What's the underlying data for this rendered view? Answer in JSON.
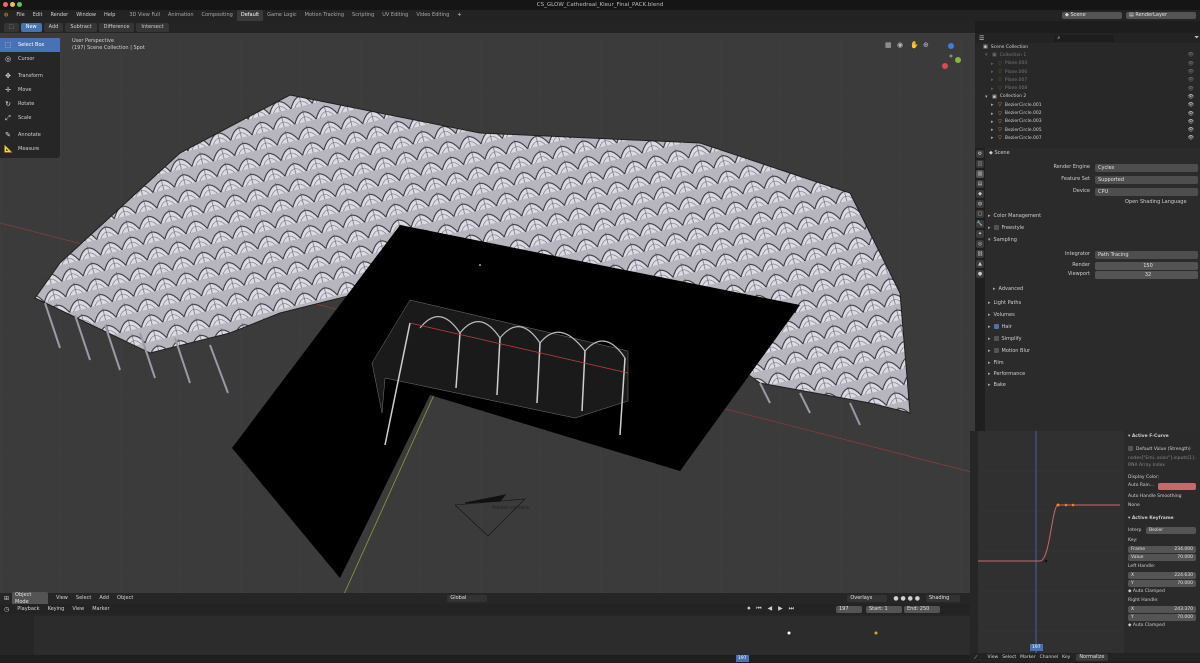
{
  "window": {
    "title": "CS_GLOW_Cathedraal_Kleur_Final_PACK.blend"
  },
  "menu": {
    "items": [
      "File",
      "Edit",
      "Render",
      "Window",
      "Help"
    ],
    "workspaces": [
      "3D View Full",
      "Animation",
      "Compositing",
      "Default",
      "Game Logic",
      "Motion Tracking",
      "Scripting",
      "UV Editing",
      "Video Editing"
    ],
    "active_workspace": "Default",
    "scene_label": "Scene",
    "renderlayer_label": "RenderLayer"
  },
  "tool_header": {
    "buttons": [
      "New",
      "Add",
      "Subtract",
      "Difference",
      "Intersect"
    ],
    "active": "New"
  },
  "toolbar": {
    "tools": [
      "Select Box",
      "Cursor",
      "Transform",
      "Move",
      "Rotate",
      "Scale",
      "Annotate",
      "Measure"
    ],
    "active": "Select Box"
  },
  "viewport": {
    "perspective": "User Perspective",
    "collection_info": "(197) Scene Collection | Spot",
    "camera_label": "Pocket camera",
    "mode": "Object Mode",
    "menus": [
      "View",
      "Select",
      "Add",
      "Object"
    ],
    "orientation": "Global",
    "overlays_label": "Overlays",
    "shading_label": "Shading"
  },
  "timeline": {
    "menus": [
      "Playback",
      "Keying",
      "View",
      "Marker"
    ],
    "current_frame": "197",
    "start_label": "Start:",
    "start": "1",
    "end_label": "End:",
    "end": "250",
    "highlight_frame": "197"
  },
  "outliner": {
    "search_placeholder": "",
    "root": "Scene Collection",
    "rows": [
      {
        "name": "Collection 1",
        "level": 1,
        "dim": true
      },
      {
        "name": "Plane.004",
        "level": 2,
        "dim": true
      },
      {
        "name": "Plane.006",
        "level": 2,
        "dim": true
      },
      {
        "name": "Plane.007",
        "level": 2,
        "dim": true
      },
      {
        "name": "Plane.008",
        "level": 2,
        "dim": true
      },
      {
        "name": "Collection 2",
        "level": 1,
        "dim": false
      },
      {
        "name": "BezierCircle.001",
        "level": 2,
        "dim": false
      },
      {
        "name": "BezierCircle.002",
        "level": 2,
        "dim": false
      },
      {
        "name": "BezierCircle.003",
        "level": 2,
        "dim": false
      },
      {
        "name": "BezierCircle.005",
        "level": 2,
        "dim": false
      },
      {
        "name": "BezierCircle.007",
        "level": 2,
        "dim": false
      }
    ]
  },
  "properties": {
    "context": "Scene",
    "render_engine_label": "Render Engine",
    "render_engine": "Cycles",
    "feature_set_label": "Feature Set",
    "feature_set": "Supported",
    "device_label": "Device",
    "device": "CPU",
    "osl_label": "Open Shading Language",
    "sections": [
      "Color Management",
      "Freestyle",
      "Sampling"
    ],
    "integrator_label": "Integrator",
    "integrator": "Path Tracing",
    "render_label": "Render",
    "render_samples": "150",
    "viewport_label": "Viewport",
    "viewport_samples": "32",
    "advanced_label": "Advanced",
    "sections2": [
      "Light Paths",
      "Volumes",
      "Hair",
      "Simplify",
      "Motion Blur",
      "Film",
      "Performance",
      "Bake"
    ],
    "hair_checked": true
  },
  "graph_panel": {
    "active_fcurve": "Active F-Curve",
    "channel": "Default Value (Strength)",
    "node_path": "nodes[\"Emi..ssion\"].inputs[1]..",
    "rna_index": "RNA Array Index",
    "display_color_label": "Display Color:",
    "display_color": "Auto Rain...",
    "display_color_swatch": "#c36b6b",
    "auto_handle_label": "Auto Handle Smoothing",
    "auto_handle": "None",
    "active_keyframe": "Active Keyframe",
    "interp_label": "Interp",
    "interp": "Bezier",
    "key_label": "Key:",
    "frame_label": "Frame",
    "frame": "234.000",
    "value_label": "Value",
    "value": "70.000",
    "left_handle_label": "Left Handle:",
    "left_x": "224.630",
    "left_y": "70.000",
    "left_type": "Auto Clamped",
    "right_handle_label": "Right Handle:",
    "right_x": "243.370",
    "right_y": "70.000",
    "right_type": "Auto Clamped",
    "x_label": "X",
    "y_label": "Y",
    "bottom_menus": [
      "View",
      "Select",
      "Marker",
      "Channel",
      "Key"
    ],
    "normalize_label": "Normalize",
    "current_frame_badge": "197"
  }
}
